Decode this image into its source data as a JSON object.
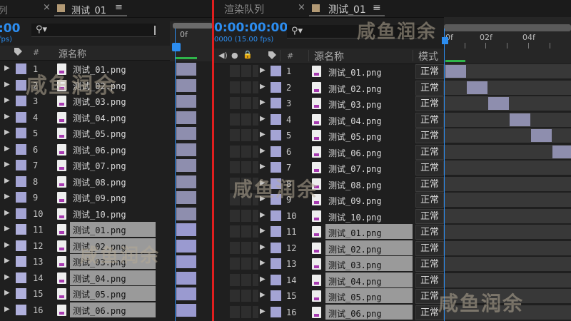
{
  "left_panel": {
    "truncated_tab": "列",
    "close_icon": "×",
    "comp_tab": "测试_01",
    "menu_icon": "≡",
    "timecode": ":00",
    "fps": "fps)",
    "search_icon": "⚲▾",
    "col_num": "#",
    "col_source": "源名称",
    "ruler_frame": "0f",
    "rows": [
      {
        "idx": "1",
        "name": "测试_01.png"
      },
      {
        "idx": "2",
        "name": "测试_02.png"
      },
      {
        "idx": "3",
        "name": "测试_03.png"
      },
      {
        "idx": "4",
        "name": "测试_04.png"
      },
      {
        "idx": "5",
        "name": "测试_05.png"
      },
      {
        "idx": "6",
        "name": "测试_06.png"
      },
      {
        "idx": "7",
        "name": "测试_07.png"
      },
      {
        "idx": "8",
        "name": "测试_08.png"
      },
      {
        "idx": "9",
        "name": "测试_09.png"
      },
      {
        "idx": "10",
        "name": "测试_10.png"
      },
      {
        "idx": "11",
        "name": "测试_01.png"
      },
      {
        "idx": "12",
        "name": "测试_02.png"
      },
      {
        "idx": "13",
        "name": "测试_03.png"
      },
      {
        "idx": "14",
        "name": "测试_04.png"
      },
      {
        "idx": "15",
        "name": "测试_05.png"
      },
      {
        "idx": "16",
        "name": "测试_06.png"
      }
    ]
  },
  "right_panel": {
    "render_queue_tab": "渲染队列",
    "close_icon": "×",
    "comp_tab": "测试_01",
    "menu_icon": "≡",
    "timecode": "0:00:00:00",
    "fps": "0000 (15.00 fps)",
    "search_icon": "⚲▾",
    "col_audio_icon": "◀)",
    "col_solo_icon": "●",
    "col_lock_icon": "🔒",
    "col_num": "#",
    "col_source": "源名称",
    "col_mode": "模式",
    "ruler_labels": [
      "0f",
      "02f",
      "04f"
    ],
    "rows": [
      {
        "idx": "1",
        "name": "测试_01.png",
        "mode": "正常"
      },
      {
        "idx": "2",
        "name": "测试_02.png",
        "mode": "正常"
      },
      {
        "idx": "3",
        "name": "测试_03.png",
        "mode": "正常"
      },
      {
        "idx": "4",
        "name": "测试_04.png",
        "mode": "正常"
      },
      {
        "idx": "5",
        "name": "测试_05.png",
        "mode": "正常"
      },
      {
        "idx": "6",
        "name": "测试_06.png",
        "mode": "正常"
      },
      {
        "idx": "7",
        "name": "测试_07.png",
        "mode": "正常"
      },
      {
        "idx": "8",
        "name": "测试_08.png",
        "mode": "正常"
      },
      {
        "idx": "9",
        "name": "测试_09.png",
        "mode": "正常"
      },
      {
        "idx": "10",
        "name": "测试_10.png",
        "mode": "正常"
      },
      {
        "idx": "11",
        "name": "测试_01.png",
        "mode": "正常"
      },
      {
        "idx": "12",
        "name": "测试_02.png",
        "mode": "正常"
      },
      {
        "idx": "13",
        "name": "测试_03.png",
        "mode": "正常"
      },
      {
        "idx": "14",
        "name": "测试_04.png",
        "mode": "正常"
      },
      {
        "idx": "15",
        "name": "测试_05.png",
        "mode": "正常"
      },
      {
        "idx": "16",
        "name": "测试_06.png",
        "mode": "正常"
      }
    ]
  },
  "watermark": "咸鱼润余",
  "colors": {
    "accent_blue": "#2c8df0",
    "divider_red": "#e01e1e",
    "label_lavender": "#a4a4d4",
    "clip_color": "#8e8eae",
    "selection_gray": "#9a9a9a"
  }
}
